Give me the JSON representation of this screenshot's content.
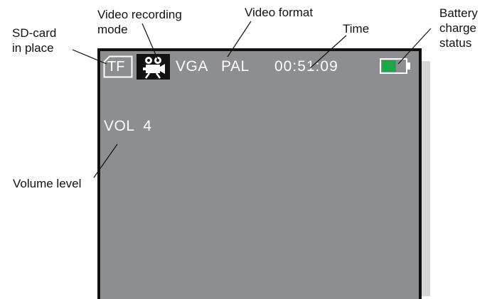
{
  "callouts": {
    "sd_card": "SD-card\nin place",
    "video_mode": "Video recording\nmode",
    "video_format": "Video format",
    "time": "Time",
    "battery": "Battery\ncharge\nstatus",
    "volume": "Volume level"
  },
  "screen": {
    "sd_label": "TF",
    "resolution": "VGA",
    "standard": "PAL",
    "time": "00:51:09",
    "volume": "VOL  4",
    "battery_level": 0.6
  },
  "colors": {
    "screen_bg": "#8d8e92",
    "osd_text": "#ffffff",
    "battery_fill": "#1fa54a",
    "frame": "#111111"
  },
  "icons": {
    "sd": "sd-card-icon",
    "video_mode": "video-camera-icon",
    "battery": "battery-icon"
  }
}
